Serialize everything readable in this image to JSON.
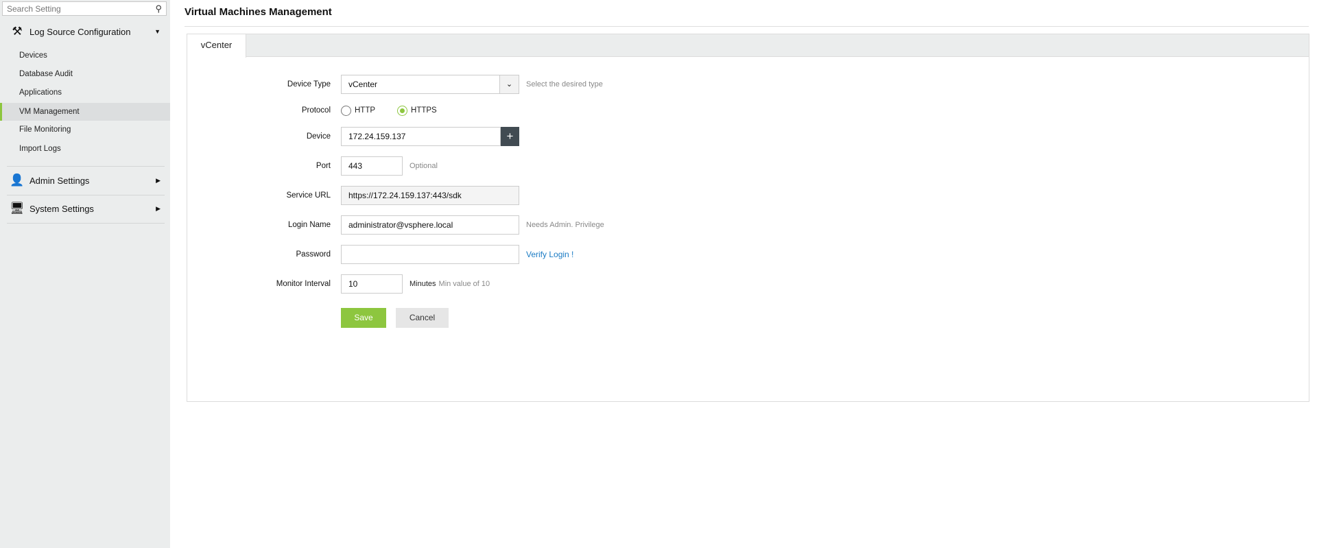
{
  "sidebar": {
    "search_placeholder": "Search Setting",
    "sections": [
      {
        "label": "Log Source Configuration",
        "items": [
          "Devices",
          "Database Audit",
          "Applications",
          "VM Management",
          "File Monitoring",
          "Import Logs"
        ]
      },
      {
        "label": "Admin Settings"
      },
      {
        "label": "System Settings"
      }
    ]
  },
  "page": {
    "title": "Virtual Machines Management",
    "tab": "vCenter"
  },
  "form": {
    "device_type": {
      "label": "Device Type",
      "value": "vCenter",
      "hint": "Select the desired type"
    },
    "protocol": {
      "label": "Protocol",
      "options": [
        "HTTP",
        "HTTPS"
      ],
      "selected": "HTTPS"
    },
    "device": {
      "label": "Device",
      "value": "172.24.159.137",
      "add": "+"
    },
    "port": {
      "label": "Port",
      "value": "443",
      "hint": "Optional"
    },
    "service_url": {
      "label": "Service URL",
      "value": "https://172.24.159.137:443/sdk"
    },
    "login_name": {
      "label": "Login Name",
      "value": "administrator@vsphere.local",
      "hint": "Needs Admin. Privilege"
    },
    "password": {
      "label": "Password",
      "value": "",
      "verify": "Verify Login !"
    },
    "monitor_interval": {
      "label": "Monitor Interval",
      "value": "10",
      "unit": "Minutes",
      "hint": "Min value of 10"
    },
    "save": "Save",
    "cancel": "Cancel"
  },
  "colors": {
    "accent": "#8dc63f",
    "link": "#1a7bc4",
    "dark_button": "#414b52"
  }
}
